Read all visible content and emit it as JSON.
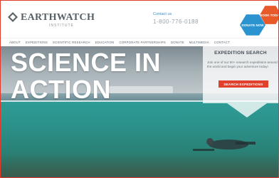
{
  "logo": {
    "name": "EARTHWATCH",
    "sub": "INSTITUTE"
  },
  "contact": {
    "label": "Contact us",
    "phone": "1-800-776-0188"
  },
  "actions": {
    "donate": "DONATE NOW",
    "book": "BOOK TODAY"
  },
  "nav": {
    "items": [
      "ABOUT",
      "EXPEDITIONS",
      "SCIENTIFIC RESEARCH",
      "EDUCATION",
      "CORPORATE PARTNERSHIPS",
      "DONATE",
      "MULTIMEDIA",
      "CONTACT"
    ]
  },
  "hero": {
    "line1": "SCIENCE IN",
    "line2": "ACTION"
  },
  "search_panel": {
    "title": "EXPEDITION SEARCH",
    "text": "Join one of our 50+ research expeditions around the world and begin your adventure today!",
    "button": "SEARCH EXPEDITIONS"
  },
  "colors": {
    "accent": "#e0402c",
    "donate": "#2a93d0",
    "book": "#e85a2a"
  }
}
